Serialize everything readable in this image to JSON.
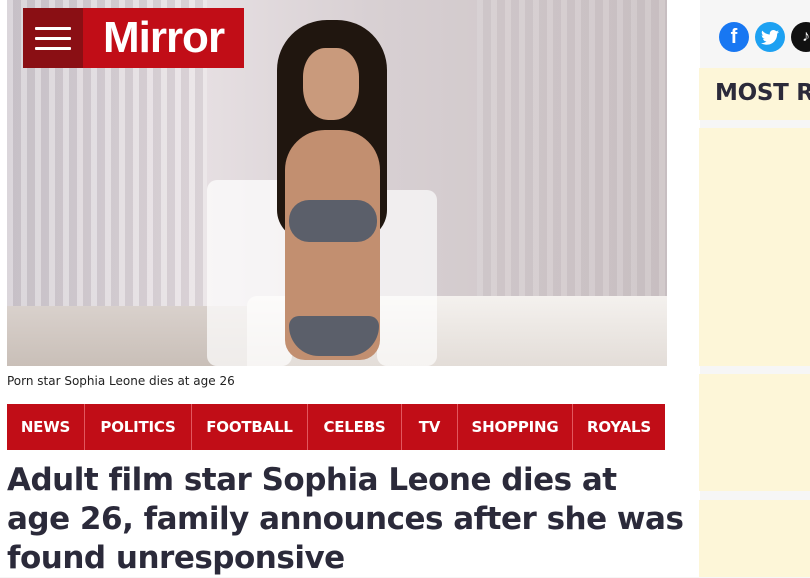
{
  "header": {
    "logo_text": "Mirror",
    "menu_icon": "hamburger-menu-icon"
  },
  "social": {
    "facebook_glyph": "f",
    "twitter_glyph": "🐦",
    "tiktok_glyph": "♪",
    "icons": [
      "facebook-icon",
      "twitter-icon",
      "tiktok-icon"
    ]
  },
  "hero": {
    "caption": "Porn star Sophia Leone dies at age 26"
  },
  "nav": {
    "items": [
      "NEWS",
      "POLITICS",
      "FOOTBALL",
      "CELEBS",
      "TV",
      "SHOPPING",
      "ROYALS"
    ]
  },
  "article": {
    "headline": "Adult film star Sophia Leone dies at age 26, family announces after she was found unresponsive"
  },
  "sidebar": {
    "heading": "MOST RE"
  },
  "colors": {
    "brand_red": "#c10d17",
    "brand_dark_red": "#8a0f14",
    "sidebar_bg": "#fdf6d8",
    "headline_text": "#2b2a3a"
  }
}
